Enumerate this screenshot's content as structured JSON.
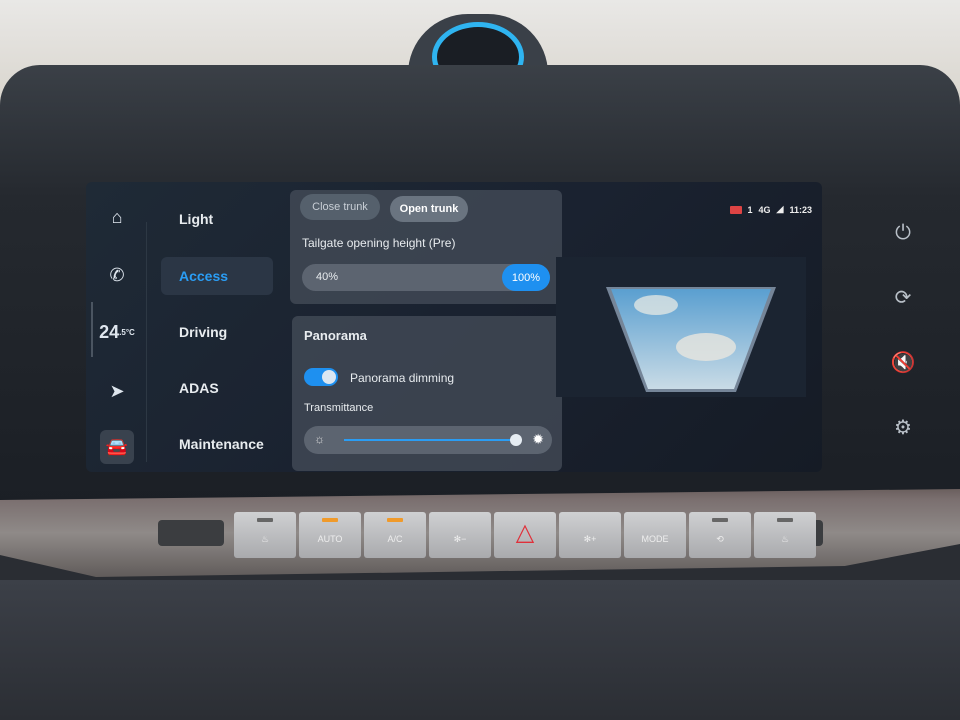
{
  "nav_rail": {
    "items": [
      {
        "icon": "home-icon"
      },
      {
        "icon": "phone-icon"
      },
      {
        "icon": "climate-temp",
        "temp": "24",
        "decimal": ".5",
        "unit": "°C"
      },
      {
        "icon": "navigation-icon"
      },
      {
        "icon": "car-icon",
        "selected": true
      }
    ]
  },
  "menu": {
    "items": [
      {
        "label": "Light"
      },
      {
        "label": "Access",
        "active": true
      },
      {
        "label": "Driving"
      },
      {
        "label": "ADAS"
      },
      {
        "label": "Maintenance"
      }
    ]
  },
  "trunk": {
    "close_label": "Close trunk",
    "open_label": "Open trunk",
    "height_label": "Tailgate opening height (Pre)",
    "min_value": "40%",
    "current_value": "100%",
    "percent": 100
  },
  "panorama": {
    "title": "Panorama",
    "dimming_label": "Panorama dimming",
    "dimming_on": true,
    "transmittance_label": "Transmittance",
    "transmittance_percent": 95
  },
  "status": {
    "signal_icon": "signal-icon",
    "network": "4G",
    "count": "1",
    "time": "11:23"
  },
  "side_buttons": [
    "power-icon",
    "refresh-icon",
    "mute-icon",
    "gear-icon"
  ],
  "hardware": {
    "buttons": [
      {
        "label": "",
        "icon": "front-defrost-icon"
      },
      {
        "label": "AUTO",
        "led": "on"
      },
      {
        "label": "A/C",
        "led": "on"
      },
      {
        "label": "",
        "icon": "fan-down-icon"
      },
      {
        "label": "",
        "icon": "hazard-icon"
      },
      {
        "label": "",
        "icon": "fan-up-icon"
      },
      {
        "label": "MODE"
      },
      {
        "label": "",
        "icon": "recirculation-icon"
      },
      {
        "label": "",
        "icon": "rear-defrost-icon"
      }
    ]
  },
  "colors": {
    "accent": "#1e90f0",
    "active_text": "#2a9df4",
    "led": "#f09a2a",
    "hazard": "#e0303a"
  }
}
